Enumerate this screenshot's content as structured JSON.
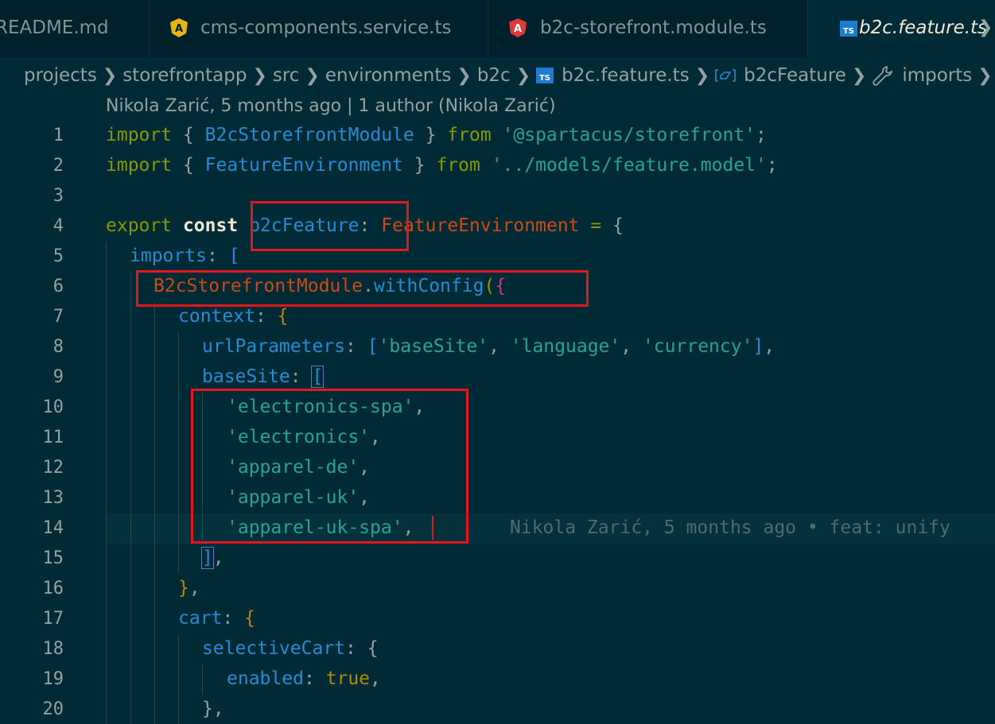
{
  "tabs": [
    {
      "label": "README.md",
      "icon": "none"
    },
    {
      "label": "cms-components.service.ts",
      "icon": "angular-service-icon"
    },
    {
      "label": "b2c-storefront.module.ts",
      "icon": "angular-module-icon"
    },
    {
      "label": "b2c.feature.ts",
      "icon": "typescript-icon",
      "active": true
    }
  ],
  "breadcrumb": {
    "items": [
      "projects",
      "storefrontapp",
      "src",
      "environments",
      "b2c",
      "b2c.feature.ts",
      "b2cFeature",
      "imports"
    ]
  },
  "codelens": "Nikola Zarić, 5 months ago | 1 author (Nikola Zarić)",
  "blame": "Nikola Zarić, 5 months ago • feat: unify",
  "line_numbers": [
    "1",
    "2",
    "3",
    "4",
    "5",
    "6",
    "7",
    "8",
    "9",
    "10",
    "11",
    "12",
    "13",
    "14",
    "15",
    "16",
    "17",
    "18",
    "19",
    "20"
  ],
  "code": {
    "l1": {
      "kw1": "import",
      "p1": " { ",
      "id": "B2cStorefrontModule",
      "p2": " } ",
      "kw2": "from",
      "sp": " ",
      "str": "'@spartacus/storefront'",
      "semi": ";"
    },
    "l2": {
      "kw1": "import",
      "p1": " { ",
      "id": "FeatureEnvironment",
      "p2": " } ",
      "kw2": "from",
      "sp": " ",
      "str": "'../models/feature.model'",
      "semi": ";"
    },
    "l4": {
      "kw1": "export",
      "kw2": "const",
      "id": "b2cFeature",
      "colon": ":",
      "type": "FeatureEnvironment",
      "eq": " = ",
      "brace": "{"
    },
    "l5": {
      "prop": "imports",
      "colon": ": ",
      "br": "["
    },
    "l6": {
      "cls": "B2cStorefrontModule",
      "dot": ".",
      "fn": "withConfig",
      "paren": "(",
      "brace": "{"
    },
    "l7": {
      "prop": "context",
      "colon": ": ",
      "brace": "{"
    },
    "l8": {
      "prop": "urlParameters",
      "colon": ": ",
      "br": "[",
      "s1": "'baseSite'",
      "c1": ", ",
      "s2": "'language'",
      "c2": ", ",
      "s3": "'currency'",
      "br2": "]",
      "comma": ","
    },
    "l9": {
      "prop": "baseSite",
      "colon": ": ",
      "br": "["
    },
    "l10": {
      "str": "'electronics-spa'",
      "comma": ","
    },
    "l11": {
      "str": "'electronics'",
      "comma": ","
    },
    "l12": {
      "str": "'apparel-de'",
      "comma": ","
    },
    "l13": {
      "str": "'apparel-uk'",
      "comma": ","
    },
    "l14": {
      "str": "'apparel-uk-spa'",
      "comma": ","
    },
    "l15": {
      "br": "]",
      "comma": ","
    },
    "l16": {
      "brace": "}",
      "comma": ","
    },
    "l17": {
      "prop": "cart",
      "colon": ": ",
      "brace": "{"
    },
    "l18": {
      "prop": "selectiveCart",
      "colon": ": ",
      "brace": "{"
    },
    "l19": {
      "prop": "enabled",
      "colon": ": ",
      "val": "true",
      "comma": ","
    },
    "l20": {
      "brace": "}",
      "comma": ","
    }
  },
  "colors": {
    "background": "#002b36",
    "keyword": "#859900",
    "string": "#2aa198",
    "property": "#268bd2",
    "type": "#cb4b16",
    "annotation_box": "#e3171b"
  }
}
